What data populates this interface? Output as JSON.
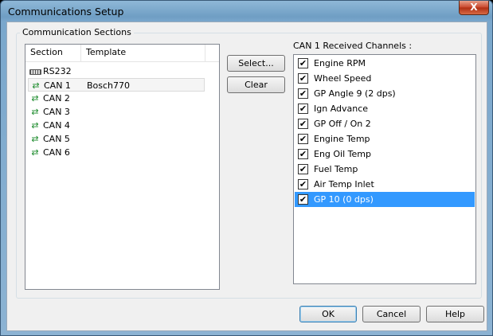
{
  "window": {
    "title": "Communications Setup",
    "close_label": "X"
  },
  "group": {
    "legend": "Communication Sections"
  },
  "sections_list": {
    "columns": [
      "Section",
      "Template"
    ],
    "rows": [
      {
        "icon": "rs232-port-icon",
        "name": "RS232",
        "template": ""
      },
      {
        "icon": "can-arrows-icon",
        "name": "CAN 1",
        "template": "Bosch770",
        "selected": true
      },
      {
        "icon": "can-arrows-icon",
        "name": "CAN 2",
        "template": ""
      },
      {
        "icon": "can-arrows-icon",
        "name": "CAN 3",
        "template": ""
      },
      {
        "icon": "can-arrows-icon",
        "name": "CAN 4",
        "template": ""
      },
      {
        "icon": "can-arrows-icon",
        "name": "CAN 5",
        "template": ""
      },
      {
        "icon": "can-arrows-icon",
        "name": "CAN 6",
        "template": ""
      }
    ]
  },
  "actions": {
    "select_label": "Select...",
    "clear_label": "Clear"
  },
  "channels": {
    "label": "CAN 1 Received Channels :",
    "items": [
      {
        "label": "Engine RPM",
        "checked": true
      },
      {
        "label": "Wheel Speed",
        "checked": true
      },
      {
        "label": "GP Angle 9 (2 dps)",
        "checked": true
      },
      {
        "label": "Ign Advance",
        "checked": true
      },
      {
        "label": "GP Off / On 2",
        "checked": true
      },
      {
        "label": "Engine Temp",
        "checked": true
      },
      {
        "label": "Eng Oil Temp",
        "checked": true
      },
      {
        "label": "Fuel Temp",
        "checked": true
      },
      {
        "label": "Air Temp Inlet",
        "checked": true
      },
      {
        "label": "GP 10 (0 dps)",
        "checked": true,
        "selected": true
      }
    ]
  },
  "footer": {
    "ok_label": "OK",
    "cancel_label": "Cancel",
    "help_label": "Help"
  },
  "colors": {
    "selection": "#3399ff",
    "can_icon": "#1a8a2a"
  }
}
